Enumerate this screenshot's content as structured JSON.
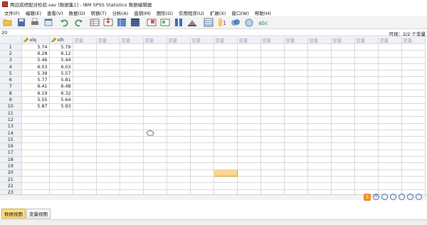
{
  "window": {
    "title": "两远成绩配对检验.sav [数据集1] - IBM SPSS Statistics 数据编辑器"
  },
  "menu": [
    "文件(F)",
    "编辑(E)",
    "查看(V)",
    "数据(D)",
    "转换(T)",
    "分析(A)",
    "直销(M)",
    "图形(G)",
    "实用程序(U)",
    "扩展(X)",
    "窗口(W)",
    "帮助(H)"
  ],
  "toolbar_icons": [
    "open-icon",
    "save-icon",
    "print-icon",
    "dialog-recall-icon",
    "undo-icon",
    "redo-icon",
    "goto-case-icon",
    "goto-variable-icon",
    "variables-icon",
    "find-icon",
    "insert-cases-icon",
    "insert-variable-icon",
    "split-file-icon",
    "weight-cases-icon",
    "select-cases-icon",
    "value-labels-icon",
    "use-sets-icon",
    "show-all-icon",
    "spell-icon"
  ],
  "info": {
    "cell_ref": "20",
    "visible": "可视：2/2 个变量"
  },
  "grid": {
    "columns": [
      "xlq",
      "xlh",
      "变量",
      "变量",
      "变量",
      "变量",
      "变量",
      "变量",
      "变量",
      "变量",
      "变量",
      "变量",
      "变量",
      "变量",
      "变量",
      "变量",
      "变量"
    ],
    "rows": [
      [
        "1",
        "5.74",
        "5.79"
      ],
      [
        "2",
        "6.28",
        "6.12"
      ],
      [
        "3",
        "5.46",
        "5.44"
      ],
      [
        "4",
        "6.03",
        "6.03"
      ],
      [
        "5",
        "5.39",
        "5.57"
      ],
      [
        "6",
        "5.77",
        "5.81"
      ],
      [
        "7",
        "6.41",
        "6.48"
      ],
      [
        "8",
        "6.19",
        "6.32"
      ],
      [
        "9",
        "5.55",
        "5.64"
      ],
      [
        "10",
        "5.87",
        "5.93"
      ],
      [
        "11",
        "",
        ""
      ],
      [
        "12",
        "",
        ""
      ],
      [
        "13",
        "",
        ""
      ],
      [
        "14",
        "",
        ""
      ],
      [
        "15",
        "",
        ""
      ],
      [
        "16",
        "",
        ""
      ],
      [
        "17",
        "",
        ""
      ],
      [
        "18",
        "",
        ""
      ],
      [
        "19",
        "",
        ""
      ],
      [
        "20",
        "",
        ""
      ],
      [
        "21",
        "",
        ""
      ],
      [
        "22",
        "",
        ""
      ],
      [
        "23",
        "",
        ""
      ]
    ],
    "selected_cell": {
      "row": "20",
      "column_index": 8
    }
  },
  "tabs": {
    "data_view": "数据视图",
    "variable_view": "变量视图"
  },
  "ime": {
    "label": "S",
    "lang": "中"
  },
  "colors": {
    "selected_cell": "#fbd88a",
    "active_tab": "#ffe082",
    "header_bg": "#eef1f5"
  }
}
